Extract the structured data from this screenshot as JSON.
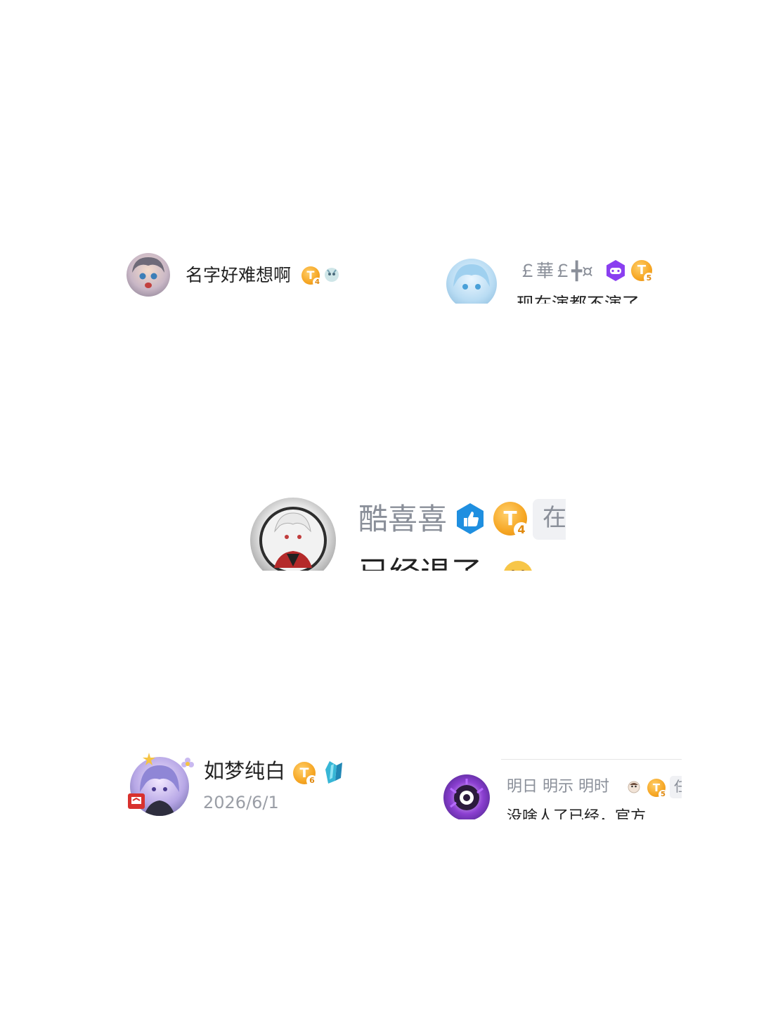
{
  "snippets": [
    {
      "username": "名字好难想啊",
      "level_badge": "T",
      "level": "4",
      "decoration_icon": "mascot-badge-icon"
    },
    {
      "username": "￡華￡╋¤",
      "comment_partial": "现在演都不演了",
      "game_badge_icon": "game-controller-icon",
      "level_badge": "T",
      "level": "5"
    },
    {
      "username": "酷喜喜",
      "like_badge_icon": "thumbs-up-icon",
      "level_badge": "T",
      "level": "4",
      "trailing_chip": "在",
      "comment_partial": "已经退了"
    },
    {
      "username": "如梦纯白",
      "level_badge": "T",
      "level": "6",
      "decoration_icon": "crystal-badge-icon",
      "date": "2026/6/1"
    },
    {
      "username": "明日 明示  明时",
      "level_badge": "T",
      "level": "5",
      "trailing_chip": "任",
      "comment_partial": "没啥人了已经，官方"
    }
  ],
  "colors": {
    "username_dark": "#222222",
    "username_gray": "#8a8f99",
    "date_gray": "#9a9ea6",
    "level_orange": "#f6a623",
    "like_blue": "#1f8fe0",
    "game_purple": "#8a3ff0"
  }
}
